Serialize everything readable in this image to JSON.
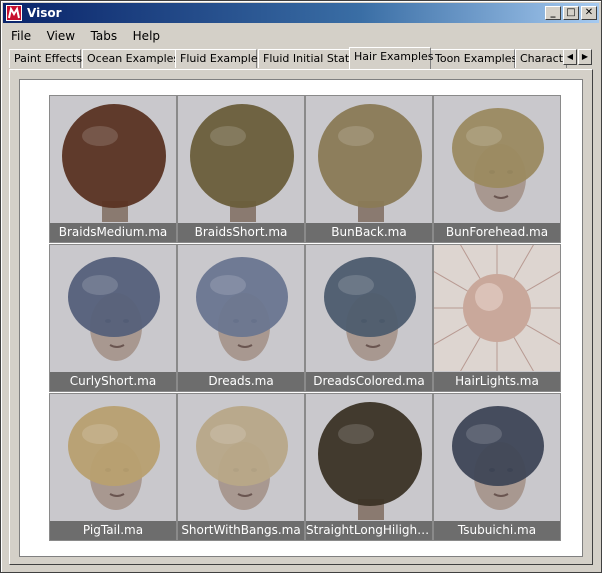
{
  "window": {
    "title": "Visor"
  },
  "menu": [
    "File",
    "View",
    "Tabs",
    "Help"
  ],
  "tabs": [
    {
      "label": "Paint Effects"
    },
    {
      "label": "Ocean Examples"
    },
    {
      "label": "Fluid Examples"
    },
    {
      "label": "Fluid Initial States"
    },
    {
      "label": "Hair Examples",
      "active": true
    },
    {
      "label": "Toon Examples"
    },
    {
      "label": "Characte"
    }
  ],
  "items": [
    {
      "label": "BraidsMedium.ma",
      "hair": "#5a3322",
      "face": false
    },
    {
      "label": "BraidsShort.ma",
      "hair": "#6a5e3a",
      "face": false
    },
    {
      "label": "BunBack.ma",
      "hair": "#8a7a55",
      "face": false
    },
    {
      "label": "BunForehead.ma",
      "hair": "#9b8a60",
      "face": true
    },
    {
      "label": "CurlyShort.ma",
      "hair": "#55607a",
      "face": true
    },
    {
      "label": "Dreads.ma",
      "hair": "#6a7690",
      "face": true
    },
    {
      "label": "DreadsColored.ma",
      "hair": "#4d5c6e",
      "face": true
    },
    {
      "label": "HairLights.ma",
      "hair": "#c9a89b",
      "face": false
    },
    {
      "label": "PigTail.ma",
      "hair": "#b8a070",
      "face": true
    },
    {
      "label": "ShortWithBangs.ma",
      "hair": "#b8a888",
      "face": true
    },
    {
      "label": "StraightLongHilight....",
      "hair": "#3b3325",
      "face": false
    },
    {
      "label": "Tsubuichi.ma",
      "hair": "#3e4656",
      "face": true
    }
  ]
}
